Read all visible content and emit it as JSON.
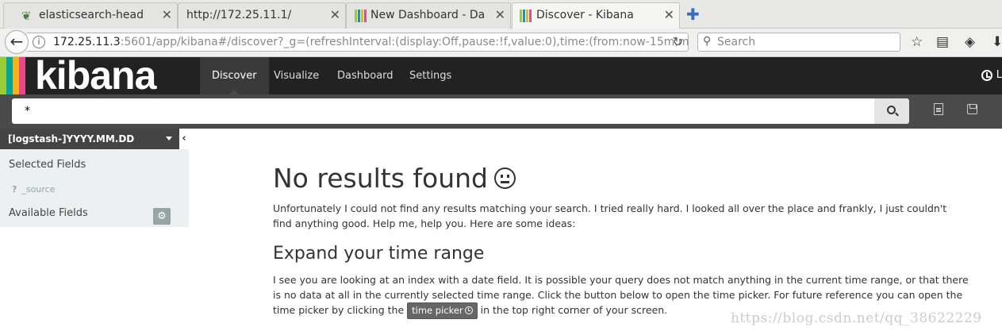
{
  "browser": {
    "tabs": [
      {
        "label": "elasticsearch-head",
        "favicon": "leaf-icon"
      },
      {
        "label": "http://172.25.11.1/",
        "favicon": ""
      },
      {
        "label": "New Dashboard - Da",
        "favicon": "kibana-icon"
      },
      {
        "label": "Discover - Kibana",
        "favicon": "kibana-icon",
        "active": true
      }
    ],
    "url_host": "172.25.11.3",
    "url_rest": ":5601/app/kibana#/discover?_g=(refreshInterval:(display:Off,pause:!f,value:0),time:(from:now-15m,m",
    "search_placeholder": "Search"
  },
  "kibana": {
    "logo_text": "kibana",
    "logo_colors": [
      "#9acc3a",
      "#00a69b",
      "#f4b21a",
      "#e8488b"
    ],
    "nav": [
      {
        "label": "Discover",
        "active": true
      },
      {
        "label": "Visualize"
      },
      {
        "label": "Dashboard"
      },
      {
        "label": "Settings"
      }
    ],
    "header_right_text": "L",
    "query_value": "*"
  },
  "sidebar": {
    "index_pattern": "[logstash-]YYYY.MM.DD",
    "collapse_glyph": "‹",
    "selected_fields_label": "Selected Fields",
    "source_type": "?",
    "source_field": "_source",
    "available_fields_label": "Available Fields"
  },
  "main": {
    "no_results_title": "No results found",
    "intro_text": "Unfortunately I could not find any results matching your search. I tried really hard. I looked all over the place and frankly, I just couldn't find anything good. Help me, help you. Here are some ideas:",
    "expand_title": "Expand your time range",
    "expand_text_before": "I see you are looking at an index with a date field. It is possible your query does not match anything in the current time range, or that there is no data at all in the currently selected time range. Click the button below to open the time picker. For future reference you can open the time picker by clicking the",
    "time_picker_label": "time picker",
    "expand_text_after": "in the top right corner of your screen."
  },
  "watermark": "https://blog.csdn.net/qq_38622229"
}
